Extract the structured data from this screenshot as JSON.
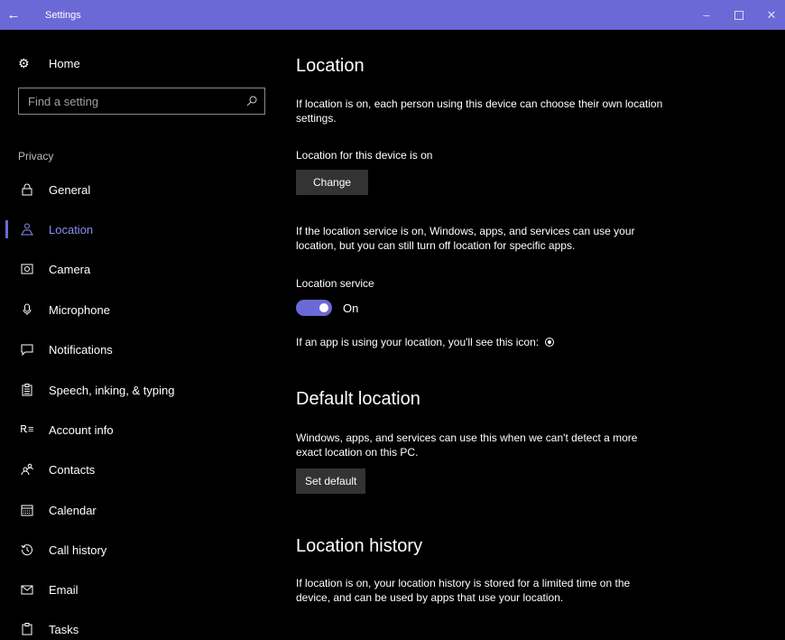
{
  "window": {
    "title": "Settings",
    "back_icon": "←",
    "minimize_icon": "–",
    "close_icon": "✕"
  },
  "sidebar": {
    "home_label": "Home",
    "search_placeholder": "Find a setting",
    "section_label": "Privacy",
    "active_item": "Location",
    "items": [
      {
        "label": "General",
        "icon": "lock-icon",
        "glyph": "🔒︎"
      },
      {
        "label": "Location",
        "icon": "location-person-icon",
        "glyph": "♙"
      },
      {
        "label": "Camera",
        "icon": "camera-icon",
        "glyph": "◙"
      },
      {
        "label": "Microphone",
        "icon": "microphone-icon",
        "glyph": "🎙︎"
      },
      {
        "label": "Notifications",
        "icon": "notifications-icon",
        "glyph": "🗨︎"
      },
      {
        "label": "Speech, inking, & typing",
        "icon": "speech-icon",
        "glyph": "📋︎"
      },
      {
        "label": "Account info",
        "icon": "account-info-icon",
        "glyph": "⅄≡"
      },
      {
        "label": "Contacts",
        "icon": "contacts-icon",
        "glyph": "ℛ"
      },
      {
        "label": "Calendar",
        "icon": "calendar-icon",
        "glyph": "▦"
      },
      {
        "label": "Call history",
        "icon": "call-history-icon",
        "glyph": "⟲"
      },
      {
        "label": "Email",
        "icon": "email-icon",
        "glyph": "✉"
      },
      {
        "label": "Tasks",
        "icon": "tasks-icon",
        "glyph": "📋︎"
      }
    ]
  },
  "main": {
    "location_heading": "Location",
    "location_desc": "If location is on, each person using this device can choose their own location settings.",
    "device_status": "Location for this device is on",
    "change_button": "Change",
    "service_desc": "If the location service is on, Windows, apps, and services can use your location, but you can still turn off location for specific apps.",
    "service_label": "Location service",
    "service_state": "On",
    "icon_note": "If an app is using your location, you'll see this icon:",
    "default_heading": "Default location",
    "default_desc": "Windows, apps, and services can use this when we can't detect a more exact location on this PC.",
    "set_default_button": "Set default",
    "history_heading": "Location history",
    "history_desc": "If location is on, your location history is stored for a limited time on the device, and can be used by apps that use your location."
  },
  "colors": {
    "accent": "#6b69d6",
    "active_text": "#8c8cf5",
    "background": "#000000"
  }
}
